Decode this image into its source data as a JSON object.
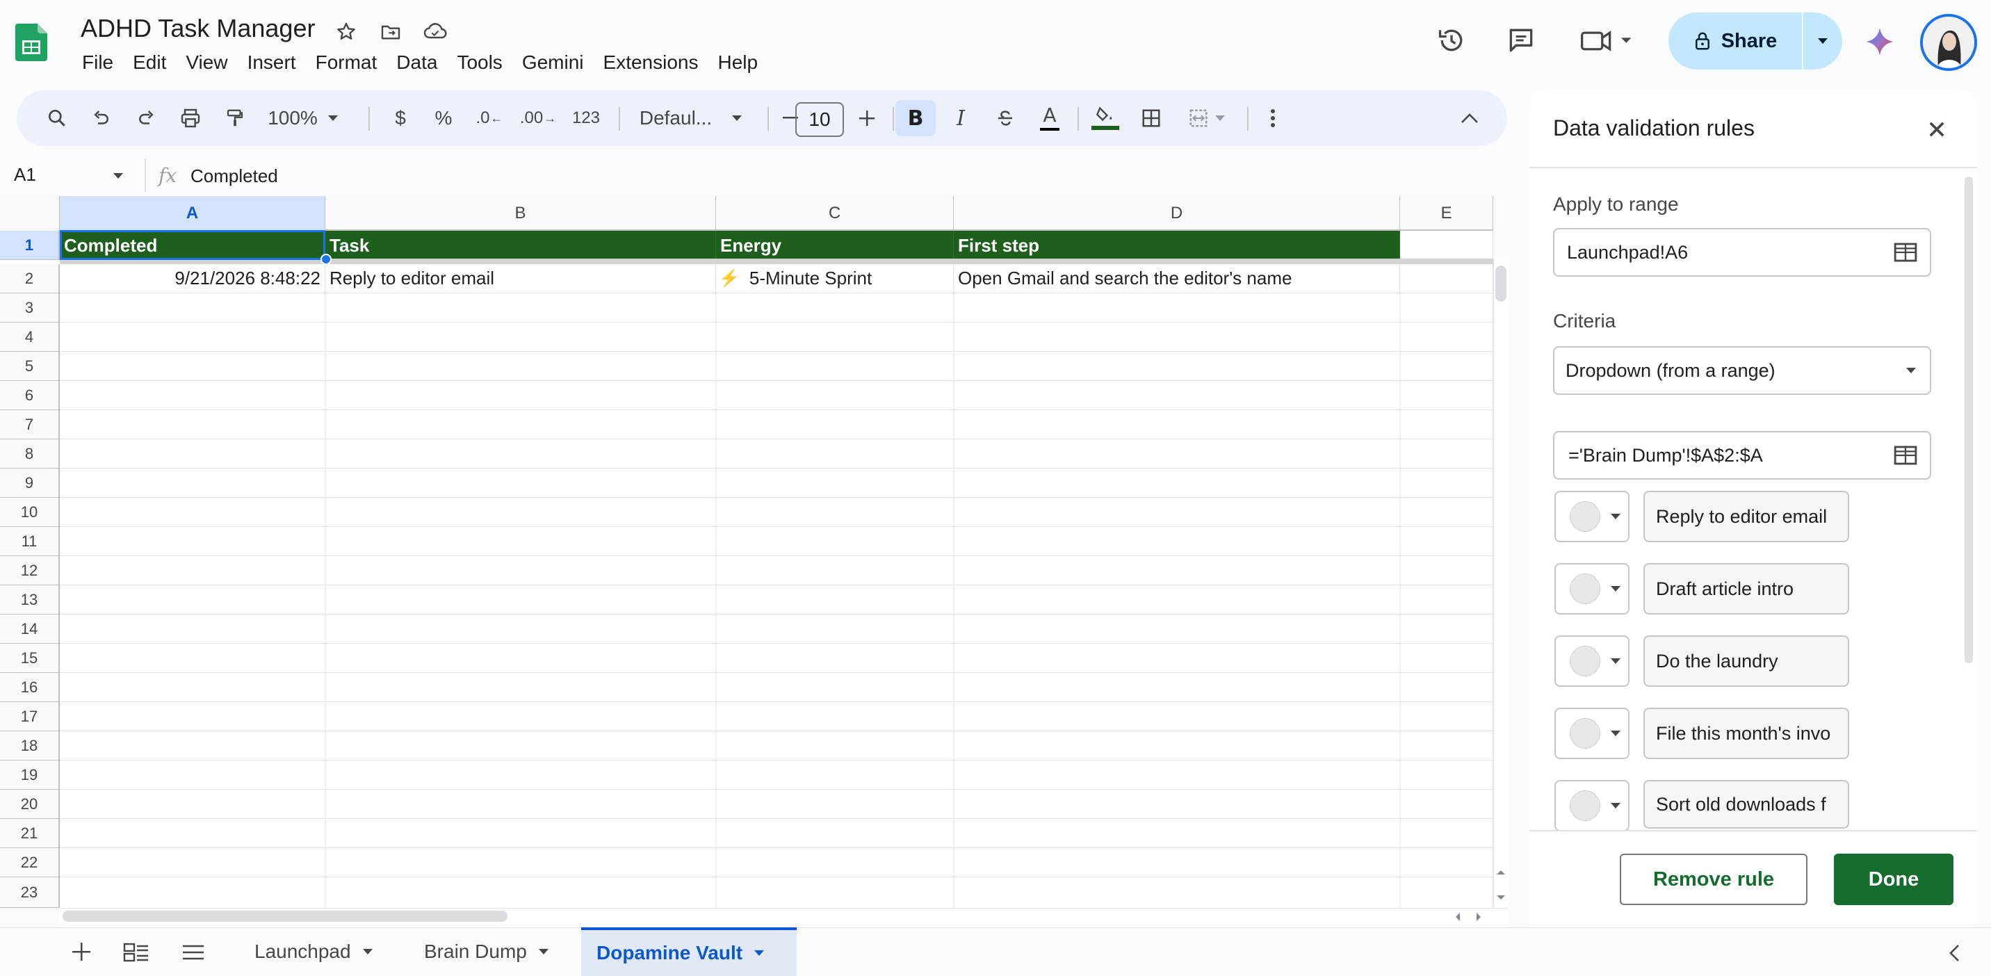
{
  "app": {
    "title": "ADHD Task Manager",
    "menu": [
      "File",
      "Edit",
      "View",
      "Insert",
      "Format",
      "Data",
      "Tools",
      "Gemini",
      "Extensions",
      "Help"
    ],
    "share_label": "Share"
  },
  "toolbar": {
    "zoom": "100%",
    "currency": "$",
    "percent": "%",
    "decrease_decimal": ".0",
    "increase_decimal": ".00",
    "number_format": "123",
    "font": "Defaul...",
    "font_size": "10"
  },
  "formula_bar": {
    "cell_ref": "A1",
    "content": "Completed"
  },
  "grid": {
    "columns": [
      "A",
      "B",
      "C",
      "D",
      "E"
    ],
    "rows": [
      "1",
      "2",
      "3",
      "4",
      "5",
      "6",
      "7",
      "8",
      "9",
      "10",
      "11",
      "12",
      "13",
      "14",
      "15",
      "16",
      "17",
      "18",
      "19",
      "20",
      "21",
      "22",
      "23"
    ],
    "header_row": [
      "Completed",
      "Task",
      "Energy",
      "First step"
    ],
    "row2": {
      "completed": "9/21/2026 8:48:22",
      "task": "Reply to editor email",
      "energy_icon": "⚡",
      "energy": "5-Minute Sprint",
      "first_step": "Open Gmail and search the editor's name"
    }
  },
  "sheets": {
    "tabs": [
      "Launchpad",
      "Brain Dump",
      "Dopamine Vault"
    ],
    "active": "Dopamine Vault"
  },
  "panel": {
    "title": "Data validation rules",
    "apply_label": "Apply to range",
    "apply_value": "Launchpad!A6",
    "criteria_label": "Criteria",
    "criteria_value": "Dropdown (from a range)",
    "range_value": "='Brain Dump'!$A$2:$A",
    "options": [
      "Reply to editor email",
      "Draft article intro",
      "Do the laundry",
      "File this month's invo",
      "Sort old downloads f"
    ],
    "remove_label": "Remove rule",
    "done_label": "Done"
  },
  "colors": {
    "header_green": "#1e5f1e",
    "accent_blue": "#1a73e8",
    "done_green": "#146c2e",
    "share_bg": "#c2e7ff"
  }
}
